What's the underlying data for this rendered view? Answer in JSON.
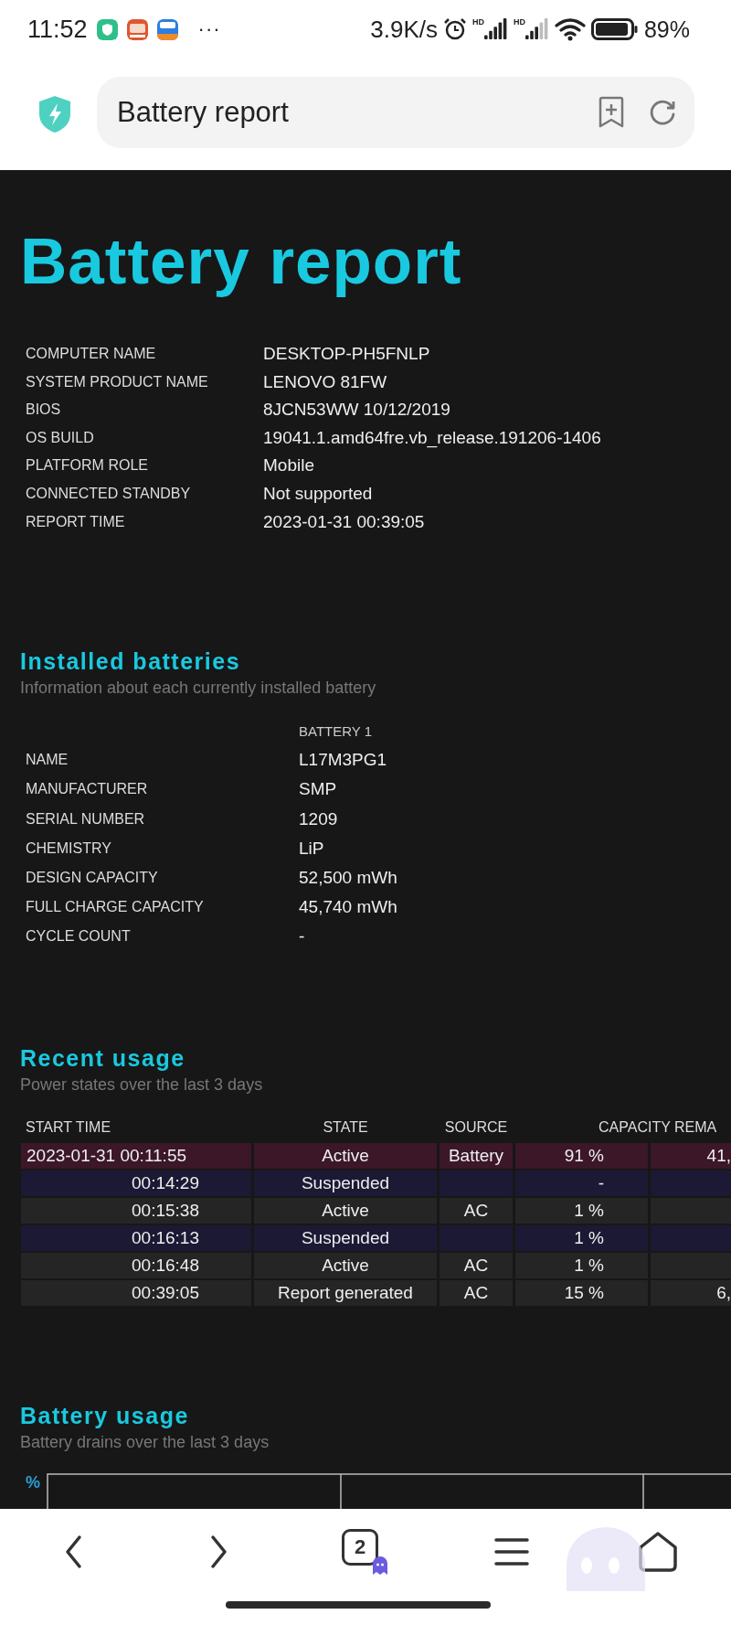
{
  "status_bar": {
    "time": "11:52",
    "more": "···",
    "speed": "3.9K/s",
    "signal_1_label": "HD",
    "signal_2_label": "HD",
    "battery_percent": "89%"
  },
  "address_bar": {
    "title": "Battery report"
  },
  "page": {
    "title": "Battery report",
    "system_info": [
      {
        "label": "COMPUTER NAME",
        "value": "DESKTOP-PH5FNLP"
      },
      {
        "label": "SYSTEM PRODUCT NAME",
        "value": "LENOVO 81FW"
      },
      {
        "label": "BIOS",
        "value": "8JCN53WW 10/12/2019"
      },
      {
        "label": "OS BUILD",
        "value": "19041.1.amd64fre.vb_release.191206-1406"
      },
      {
        "label": "PLATFORM ROLE",
        "value": "Mobile"
      },
      {
        "label": "CONNECTED STANDBY",
        "value": "Not supported"
      },
      {
        "label": "REPORT TIME",
        "value": "2023-01-31 00:39:05"
      }
    ],
    "installed_batteries": {
      "heading": "Installed batteries",
      "subtitle": "Information about each currently installed battery",
      "column": "BATTERY 1",
      "rows": [
        {
          "label": "NAME",
          "value": "L17M3PG1"
        },
        {
          "label": "MANUFACTURER",
          "value": "SMP"
        },
        {
          "label": "SERIAL NUMBER",
          "value": "1209"
        },
        {
          "label": "CHEMISTRY",
          "value": "LiP"
        },
        {
          "label": "DESIGN CAPACITY",
          "value": "52,500 mWh"
        },
        {
          "label": "FULL CHARGE CAPACITY",
          "value": "45,740 mWh"
        },
        {
          "label": "CYCLE COUNT",
          "value": "-"
        }
      ]
    },
    "recent_usage": {
      "heading": "Recent usage",
      "subtitle": "Power states over the last 3 days",
      "columns": [
        "START TIME",
        "STATE",
        "SOURCE",
        "CAPACITY REMA"
      ],
      "rows": [
        {
          "start_time": "2023-01-31  00:11:55",
          "state": "Active",
          "source": "Battery",
          "capacity": "91 %",
          "column_5": "41,",
          "color": "#3b1728"
        },
        {
          "start_time": "00:14:29",
          "state": "Suspended",
          "source": "",
          "capacity": "-",
          "column_5": "",
          "color": "#1b1934"
        },
        {
          "start_time": "00:15:38",
          "state": "Active",
          "source": "AC",
          "capacity": "1 %",
          "column_5": "",
          "color": "#252525"
        },
        {
          "start_time": "00:16:13",
          "state": "Suspended",
          "source": "",
          "capacity": "1 %",
          "column_5": "",
          "color": "#1b1934"
        },
        {
          "start_time": "00:16:48",
          "state": "Active",
          "source": "AC",
          "capacity": "1 %",
          "column_5": "",
          "color": "#252525"
        },
        {
          "start_time": "00:39:05",
          "state": "Report generated",
          "source": "AC",
          "capacity": "15 %",
          "column_5": "6,",
          "color": "#252525"
        }
      ]
    },
    "battery_usage": {
      "heading": "Battery usage",
      "subtitle": "Battery drains over the last 3 days",
      "axis_unit": "%"
    }
  },
  "bottom_bar": {
    "tab_count": "2"
  }
}
